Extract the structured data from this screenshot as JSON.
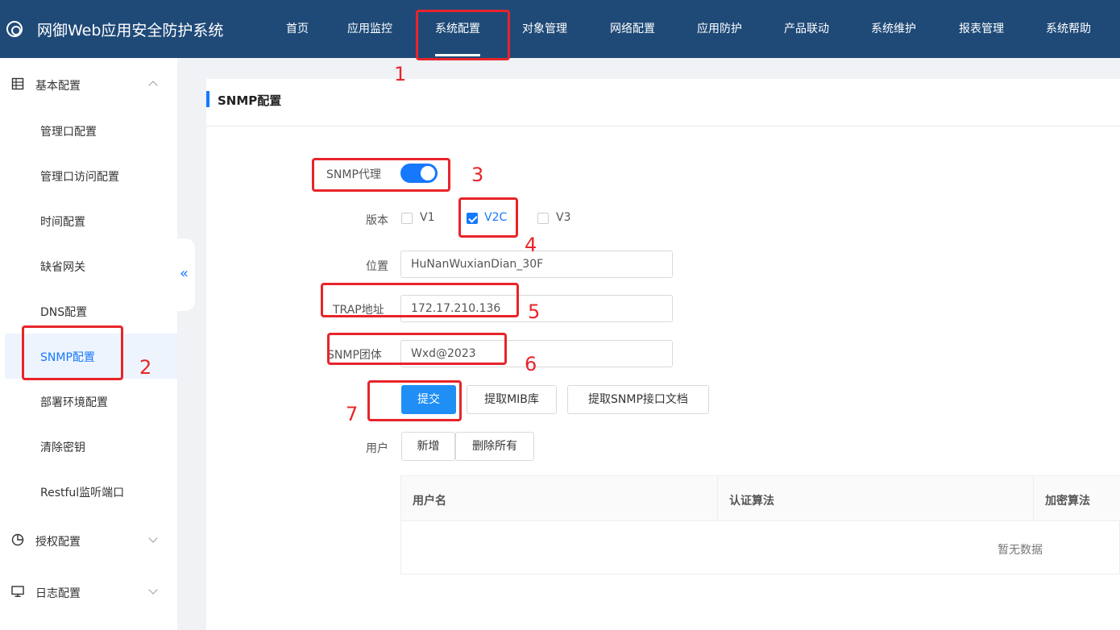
{
  "header": {
    "title": "网御Web应用安全防护系统",
    "nav": [
      "首页",
      "应用监控",
      "系统配置",
      "对象管理",
      "网络配置",
      "应用防护",
      "产品联动",
      "系统维护",
      "报表管理",
      "系统帮助"
    ],
    "active_nav": "系统配置"
  },
  "sidebar": {
    "groups": [
      {
        "label": "基本配置",
        "icon": "list-icon",
        "expanded": true
      },
      {
        "label": "授权配置",
        "icon": "chart-icon",
        "expanded": false
      },
      {
        "label": "日志配置",
        "icon": "monitor-icon",
        "expanded": false
      }
    ],
    "items": [
      "管理口配置",
      "管理口访问配置",
      "时间配置",
      "缺省网关",
      "DNS配置",
      "SNMP配置",
      "部署环境配置",
      "清除密钥",
      "Restful监听端口"
    ],
    "active_item": "SNMP配置",
    "collapse_glyph": "«"
  },
  "main": {
    "section_title": "SNMP配置",
    "form": {
      "agent_label": "SNMP代理",
      "agent_enabled": true,
      "version_label": "版本",
      "versions": [
        {
          "label": "V1",
          "checked": false
        },
        {
          "label": "V2C",
          "checked": true
        },
        {
          "label": "V3",
          "checked": false
        }
      ],
      "location_label": "位置",
      "location_value": "HuNanWuxianDian_30F",
      "trap_label": "TRAP地址",
      "trap_value": "172.17.210.136",
      "community_label": "SNMP团体",
      "community_value": "Wxd@2023",
      "submit_label": "提交",
      "mib_label": "提取MIB库",
      "doc_label": "提取SNMP接口文档",
      "user_label": "用户",
      "add_label": "新增",
      "delete_all_label": "删除所有"
    },
    "table": {
      "columns": [
        "用户名",
        "认证算法",
        "加密算法"
      ],
      "rows": [],
      "empty_text": "暂无数据"
    }
  },
  "annotations": [
    "1",
    "2",
    "3",
    "4",
    "5",
    "6",
    "7"
  ],
  "colors": {
    "header_bg": "#1f4a78",
    "accent": "#1677ff",
    "annotation": "#e8242b"
  }
}
